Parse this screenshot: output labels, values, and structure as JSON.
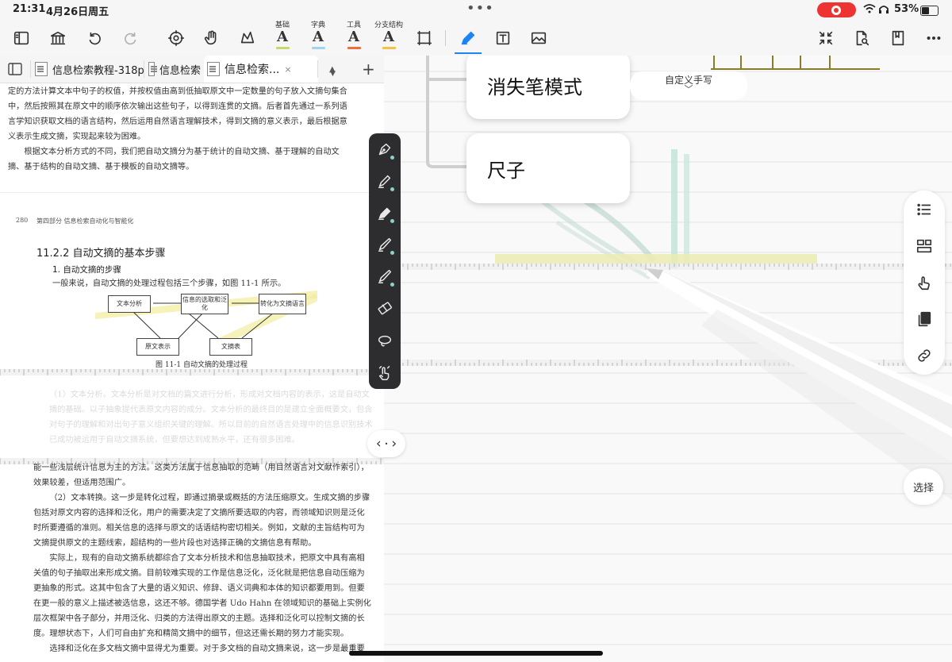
{
  "status_bar": {
    "time": "21:31",
    "date": "4月26日周五",
    "battery_text": "53%",
    "battery_level": 0.53
  },
  "toolbar": {
    "left_icons": [
      "sidebar-icon",
      "library-icon",
      "undo-icon",
      "redo-icon",
      "settings-icon",
      "hand-icon",
      "lasso-icon"
    ],
    "style_presets": [
      {
        "label": "基础",
        "glyph": "A",
        "color": "#c9d86a"
      },
      {
        "label": "字典",
        "glyph": "A",
        "color": "#9cd6f2"
      },
      {
        "label": "工具",
        "glyph": "A",
        "color": "#f26d3d"
      },
      {
        "label": "分支结构",
        "glyph": "A",
        "color": "#f6c244"
      }
    ],
    "right_icons": [
      "frame-icon",
      "pen-icon",
      "text-box-icon",
      "image-icon",
      "collapse-icon",
      "search-doc-icon",
      "bookmark-icon",
      "more-icon"
    ],
    "accent": "#1d84f5"
  },
  "tabs": [
    {
      "label": "信息检索教程-318p"
    },
    {
      "label": "信息检索"
    },
    {
      "label": "信息检索..."
    }
  ],
  "document": {
    "para_top": "定的方法计算文本中句子的权值，并按权值由高到低抽取原文中一定数量的句子放入文摘句集合中，然后按照其在原文中的顺序依次输出这些句子，以得到连贯的文摘。后者首先通过一系列语言学知识获取文档的语言结构，然后运用自然语言理解技术，得到文摘的意义表示，最后根据意义表示生成文摘，实现起来较为困难。",
    "para_top2": "根据文本分析方式的不同，我们把自动文摘分为基于统计的自动文摘、基于理解的自动文摘、基于结构的自动文摘、基于模板的自动文摘等。",
    "page_number": "280",
    "page_section": "第四部分   信息检索自动化与智能化",
    "section_heading": "11.2.2   自动文摘的基本步骤",
    "sub_heading": "1. 自动文摘的步骤",
    "intro_line": "一般来说，自动文摘的处理过程包括三个步骤，如图 11-1 所示。",
    "figure": {
      "box1": "文本分析",
      "box2": "信息的选取和泛化",
      "box3": "转化为文摘语言",
      "box4": "原文表示",
      "box5": "文摘表",
      "caption": "图 11-1   自动文摘的处理过程"
    },
    "faded_text": "（1）文本分析。文本分析是对文档的篇文进行分析，形成对文档内容的表示，这是自动文摘的基础。以子抽象提代表原文内容的成分。文本分析的最终目的是建立全面概要文，包含对句子的理解和对出句子意义组织关键的理解。所以目前的自然语言处理中的信息识别技术已成功被运用于自动文摘系统，但要想达到成熟水平，还有很多困难。",
    "para_low1": "能一些浅层统计信息为主的方法。这类方法属于信息抽取的范畴（用目然语言对文献作索引），效果较差，但适用范围广。",
    "para_low2": "（2）文本转换。这一步是转化过程，即通过摘录或概括的方法压缩原文。生成文摘的步骤包括对原文内容的选择和泛化，用户的需要决定了文摘所要选取的内容，而领域知识则是泛化时所要遵循的准则。相关信息的选择与原文的话语结构密切相关。例如，文献的主旨结构可为文摘提供原文的主题线索，超结构的一些片段也对选择正确的文摘信息有帮助。",
    "para_low3": "实际上，现有的自动文摘系统都综合了文本分析技术和信息抽取技术，把原文中具有高相关值的句子抽取出来形成文摘。目前较难实现的工作是信息泛化，泛化就是把信息自动压缩为更抽象的形式。这其中包含了大量的语义知识、修辞、语义词典和本体的知识都要用到。但要在更一般的意义上描述被选信息，这还不够。德国学者 Udo Hahn 在领域知识的基础上实例化层次框架中各子部分，并用泛化、归类的方法得出原文的主题。选择和泛化可以控制文摘的长度。理想状态下，人们可自由扩充和精简文摘中的细节，但这还需长期的努力才能实现。",
    "para_low4": "选择和泛化在多文档文摘中显得尤为重要。对于多文档的自动文摘来说，这一步是最重要"
  },
  "canvas": {
    "node1": "消失笔模式",
    "node2": "尺子",
    "custom_handwriting": "自定义手写",
    "select_label": "选择",
    "side_panel_icons": [
      "list-icon",
      "layout-icon",
      "hand-point-icon",
      "copy-icon",
      "link-icon"
    ]
  },
  "pen_palette": {
    "tools": [
      "fountain-pen-icon",
      "highlighter-icon",
      "marker-icon",
      "pencil-icon",
      "brush-icon",
      "eraser-icon",
      "lasso-icon",
      "touch-hand-icon"
    ],
    "dot_color": "#8fcfc6"
  }
}
